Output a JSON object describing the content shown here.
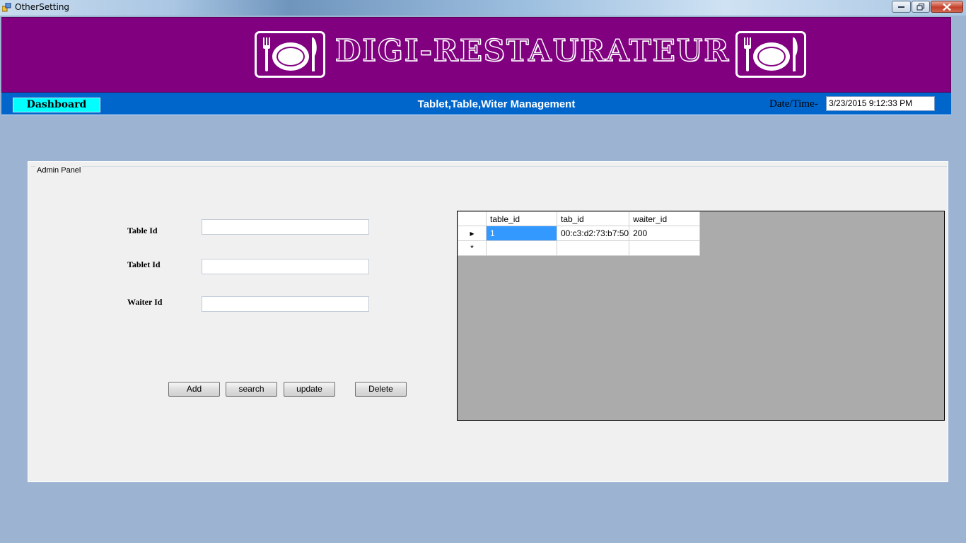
{
  "window": {
    "title": "OtherSetting"
  },
  "header": {
    "brand": "DIGI-RESTAURATEUR",
    "icon": "plate-fork-knife-icon",
    "background_color": "#800080"
  },
  "navbar": {
    "dashboard_label": "Dashboard",
    "title": "Tablet,Table,Witer Management",
    "datetime_label": "Date/Time-",
    "datetime_value": "3/23/2015 9:12:33 PM",
    "background_color": "#0066cc"
  },
  "panel": {
    "legend": "Admin Panel",
    "fields": [
      {
        "label": "Table Id",
        "value": ""
      },
      {
        "label": "Tablet Id",
        "value": ""
      },
      {
        "label": "Waiter Id",
        "value": ""
      }
    ],
    "buttons": {
      "add": "Add",
      "search": "search",
      "update": "update",
      "delete": "Delete"
    }
  },
  "grid": {
    "columns": [
      "table_id",
      "tab_id",
      "waiter_id"
    ],
    "rows": [
      {
        "table_id": "1",
        "tab_id": "00:c3:d2:73:b7:50",
        "waiter_id": "200"
      }
    ],
    "current_row_marker": "▸",
    "new_row_marker": "*"
  }
}
